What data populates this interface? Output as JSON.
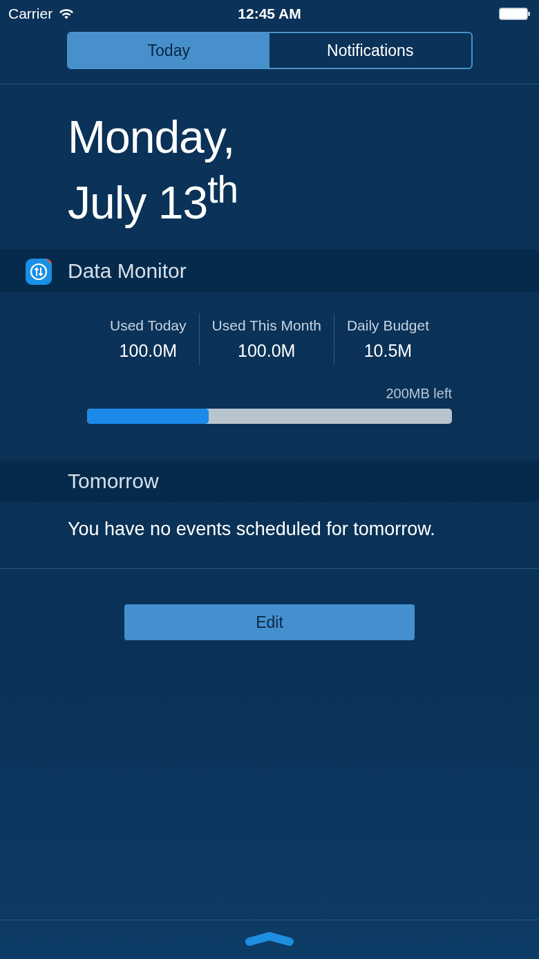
{
  "status_bar": {
    "carrier": "Carrier",
    "time": "12:45 AM"
  },
  "tabs": [
    {
      "label": "Today",
      "selected": true
    },
    {
      "label": "Notifications",
      "selected": false
    }
  ],
  "date": {
    "line_1": "Monday,",
    "line_2": "July 13$^{th}$"
  },
  "widget": {
    "title": "Data Monitor",
    "stats": [
      {
        "label": "Used Today",
        "value": "100.0M"
      },
      {
        "label": "Used This Month",
        "value": "100.0M"
      },
      {
        "label": "Daily Budget",
        "value": "10.5M"
      }
    ],
    "remaining": "200MB left",
    "level": 0.333
  },
  "tomorrow": {
    "title": "Tomorrow",
    "message": "You have no events scheduled for tomorrow."
  },
  "edit_button": "Edit"
}
